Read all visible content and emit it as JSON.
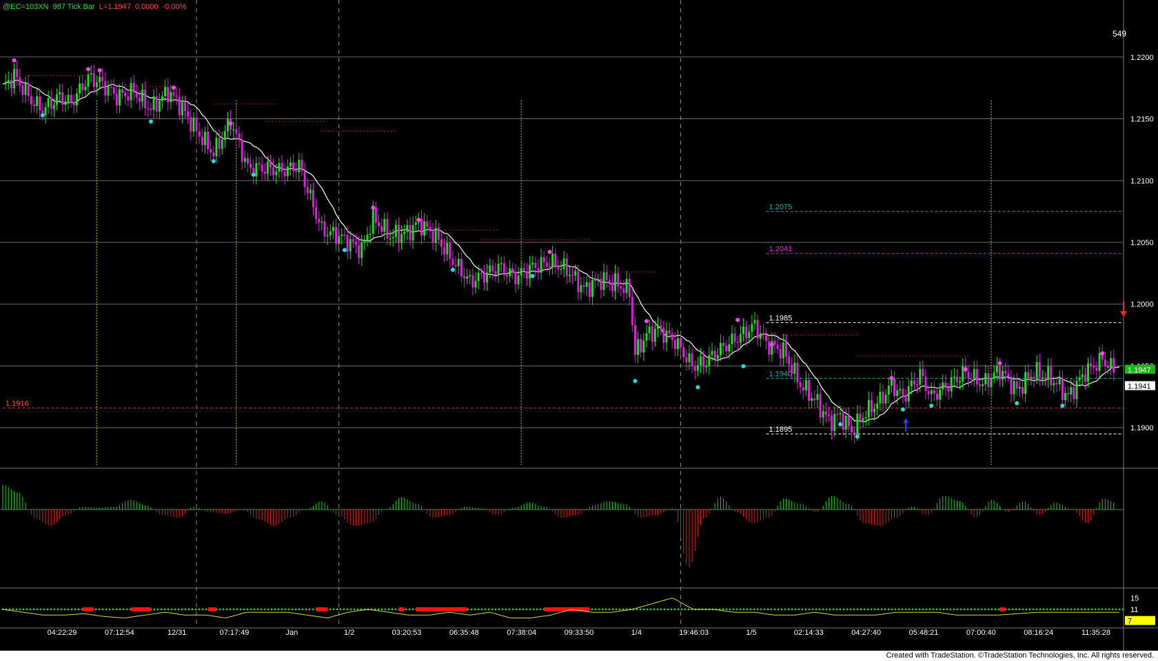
{
  "header": {
    "symbol": "@EC=103XN",
    "bar_type": "987 Tick Bar",
    "last_label": "L=1.1947",
    "change": "0.0000",
    "change_pct": "-0.00%"
  },
  "bar_counter": "549",
  "footer": {
    "credit": "Created with TradeStation. ©TradeStation Technologies, Inc. All rights reserved."
  },
  "colors": {
    "background": "#000000",
    "up_bar": "#22dd22",
    "down_bar": "#dd22dd",
    "pivot_high": "#ff44ff",
    "pivot_low": "#22dddd",
    "moving_average": "#ffffff",
    "osc_positive": "#22cc22",
    "osc_negative": "#dd2222",
    "support_line": "#dd2222",
    "header_text": "#33dd33"
  },
  "chart_data": [
    {
      "type": "candlestick",
      "panel": "price",
      "ylim": [
        1.187,
        1.2235
      ],
      "yticks": [
        "1.2200",
        "1.2150",
        "1.2100",
        "1.2050",
        "1.2000",
        "1.1950",
        "1.1900"
      ],
      "xticks": [
        "04:22:29",
        "07:12:54",
        "12/31",
        "07:17:49",
        "Jan",
        "1/2",
        "03:20:53",
        "06:35:48",
        "07:38:04",
        "09:33:50",
        "1/4",
        "19:46:03",
        "1/5",
        "02:14:33",
        "04:27:40",
        "05:48:21",
        "07:00:40",
        "08:16:24",
        "11:35:28"
      ],
      "close_path": [
        [
          0,
          1.2175
        ],
        [
          4,
          1.2185
        ],
        [
          10,
          1.2165
        ],
        [
          14,
          1.2157
        ],
        [
          20,
          1.2168
        ],
        [
          24,
          1.2163
        ],
        [
          30,
          1.2183
        ],
        [
          34,
          1.218
        ],
        [
          40,
          1.2168
        ],
        [
          46,
          1.2172
        ],
        [
          52,
          1.2158
        ],
        [
          58,
          1.2172
        ],
        [
          62,
          1.2162
        ],
        [
          68,
          1.214
        ],
        [
          74,
          1.2122
        ],
        [
          80,
          1.2148
        ],
        [
          86,
          1.211
        ],
        [
          92,
          1.211
        ],
        [
          98,
          1.2108
        ],
        [
          104,
          1.2112
        ],
        [
          112,
          1.206
        ],
        [
          118,
          1.2055
        ],
        [
          126,
          1.2044
        ],
        [
          130,
          1.207
        ],
        [
          136,
          1.2055
        ],
        [
          142,
          1.2058
        ],
        [
          146,
          1.2066
        ],
        [
          152,
          1.2055
        ],
        [
          158,
          1.2035
        ],
        [
          164,
          1.2018
        ],
        [
          170,
          1.2025
        ],
        [
          174,
          1.203
        ],
        [
          180,
          1.2022
        ],
        [
          186,
          1.203
        ],
        [
          192,
          1.2034
        ],
        [
          198,
          1.2028
        ],
        [
          204,
          1.2012
        ],
        [
          210,
          1.202
        ],
        [
          216,
          1.2016
        ],
        [
          220,
          1.201
        ],
        [
          222,
          1.196
        ],
        [
          226,
          1.1975
        ],
        [
          230,
          1.198
        ],
        [
          236,
          1.197
        ],
        [
          242,
          1.195
        ],
        [
          246,
          1.1952
        ],
        [
          250,
          1.196
        ],
        [
          256,
          1.197
        ],
        [
          260,
          1.1976
        ],
        [
          264,
          1.1983
        ],
        [
          268,
          1.1968
        ],
        [
          274,
          1.1962
        ],
        [
          280,
          1.1935
        ],
        [
          286,
          1.192
        ],
        [
          290,
          1.1905
        ],
        [
          294,
          1.191
        ],
        [
          298,
          1.1897
        ],
        [
          302,
          1.191
        ],
        [
          308,
          1.1922
        ],
        [
          312,
          1.1935
        ],
        [
          316,
          1.1925
        ],
        [
          322,
          1.1943
        ],
        [
          326,
          1.1925
        ],
        [
          332,
          1.1935
        ],
        [
          338,
          1.1945
        ],
        [
          344,
          1.1935
        ],
        [
          350,
          1.1947
        ],
        [
          356,
          1.193
        ],
        [
          362,
          1.1945
        ],
        [
          368,
          1.194
        ],
        [
          374,
          1.1925
        ],
        [
          380,
          1.1945
        ],
        [
          386,
          1.1955
        ],
        [
          390,
          1.1947
        ]
      ],
      "series": [
        {
          "name": "",
          "kind": "moving_average",
          "values_source": "smoothed_close"
        }
      ],
      "pivots": {
        "highs": [
          [
            4,
            1.2195
          ],
          [
            30,
            1.2188
          ],
          [
            34,
            1.2187
          ],
          [
            60,
            1.2173
          ],
          [
            80,
            1.2144
          ],
          [
            130,
            1.2076
          ],
          [
            146,
            1.2066
          ],
          [
            192,
            1.204
          ],
          [
            226,
            1.1984
          ],
          [
            258,
            1.1985
          ],
          [
            270,
            1.1965
          ],
          [
            312,
            1.1938
          ],
          [
            338,
            1.1945
          ],
          [
            350,
            1.195
          ],
          [
            386,
            1.1958
          ]
        ],
        "lows": [
          [
            14,
            1.2155
          ],
          [
            52,
            1.215
          ],
          [
            74,
            1.2118
          ],
          [
            88,
            1.2107
          ],
          [
            120,
            1.2046
          ],
          [
            158,
            1.203
          ],
          [
            186,
            1.2025
          ],
          [
            222,
            1.194
          ],
          [
            244,
            1.1935
          ],
          [
            260,
            1.1952
          ],
          [
            294,
            1.1905
          ],
          [
            300,
            1.1895
          ],
          [
            316,
            1.1917
          ],
          [
            326,
            1.192
          ],
          [
            356,
            1.1922
          ],
          [
            372,
            1.192
          ]
        ]
      },
      "horizontal_levels": [
        {
          "label": "1.2075",
          "value": 1.2075,
          "color": "#22aaaa",
          "start": 268
        },
        {
          "label": "1.2041",
          "value": 1.2041,
          "color": "#dd22dd",
          "start": 268
        },
        {
          "label": "1.1985",
          "value": 1.1985,
          "color": "#ffffff",
          "start": 268
        },
        {
          "label": "1.1940",
          "value": 1.194,
          "color": "#22aaaa",
          "start": 268
        },
        {
          "label": "1.1895",
          "value": 1.1895,
          "color": "#ffffff",
          "start": 268
        },
        {
          "label": "1.1916",
          "value": 1.1916,
          "color": "#dd2222",
          "start": 0
        }
      ],
      "last_price": {
        "label": "1.1947",
        "value": 1.1947
      },
      "ma_value": {
        "label": "1.1941",
        "value": 1.1941
      }
    },
    {
      "type": "area",
      "panel": "oscillator",
      "ylim": [
        -1,
        1
      ],
      "values": [
        0.9,
        0.6,
        -0.3,
        -0.6,
        -0.2,
        0.1,
        0.05,
        0.1,
        0.35,
        0.15,
        -0.2,
        -0.3,
        0.1,
        -0.1,
        -0.15,
        0.0,
        -0.35,
        -0.6,
        -0.3,
        0.0,
        0.3,
        -0.2,
        -0.6,
        -0.5,
        0.0,
        0.45,
        0.2,
        -0.3,
        -0.2,
        0.1,
        0.05,
        -0.2,
        0.05,
        0.25,
        0.1,
        -0.3,
        -0.2,
        0.15,
        0.3,
        0.2,
        -0.3,
        -0.2,
        0.05,
        -2.1,
        -0.3,
        0.45,
        -0.1,
        -0.5,
        -0.3,
        0.4,
        0.2,
        -0.1,
        0.5,
        0.2,
        -0.5,
        -0.6,
        -0.3,
        0.1,
        -0.2,
        0.5,
        0.3,
        -0.3,
        0.35,
        -0.1,
        0.3,
        -0.2,
        0.25,
        0.0,
        -0.5,
        0.4,
        0.2
      ]
    },
    {
      "type": "line",
      "panel": "indicator",
      "yticks": [
        "15",
        "11",
        "7"
      ],
      "ylim": [
        5,
        17
      ],
      "reference_line": 11,
      "red_segments": [
        [
          28,
          32
        ],
        [
          45,
          52
        ],
        [
          72,
          75
        ],
        [
          110,
          114
        ],
        [
          139,
          141
        ],
        [
          145,
          163
        ],
        [
          190,
          206
        ],
        [
          350,
          352
        ]
      ],
      "series": [
        {
          "name": "",
          "values": [
            11,
            10,
            9,
            9,
            9.5,
            8.5,
            8,
            9,
            10,
            9,
            9,
            8,
            10,
            10,
            10,
            9,
            8,
            10,
            11,
            10,
            9,
            9,
            10,
            9,
            10,
            8,
            8,
            9,
            11,
            10,
            10,
            11,
            13,
            15,
            11,
            11,
            10,
            10,
            9,
            9,
            10,
            9,
            9,
            9,
            10,
            10,
            10,
            9,
            9,
            9,
            9.5,
            10,
            10,
            10,
            10,
            10
          ]
        }
      ]
    }
  ]
}
